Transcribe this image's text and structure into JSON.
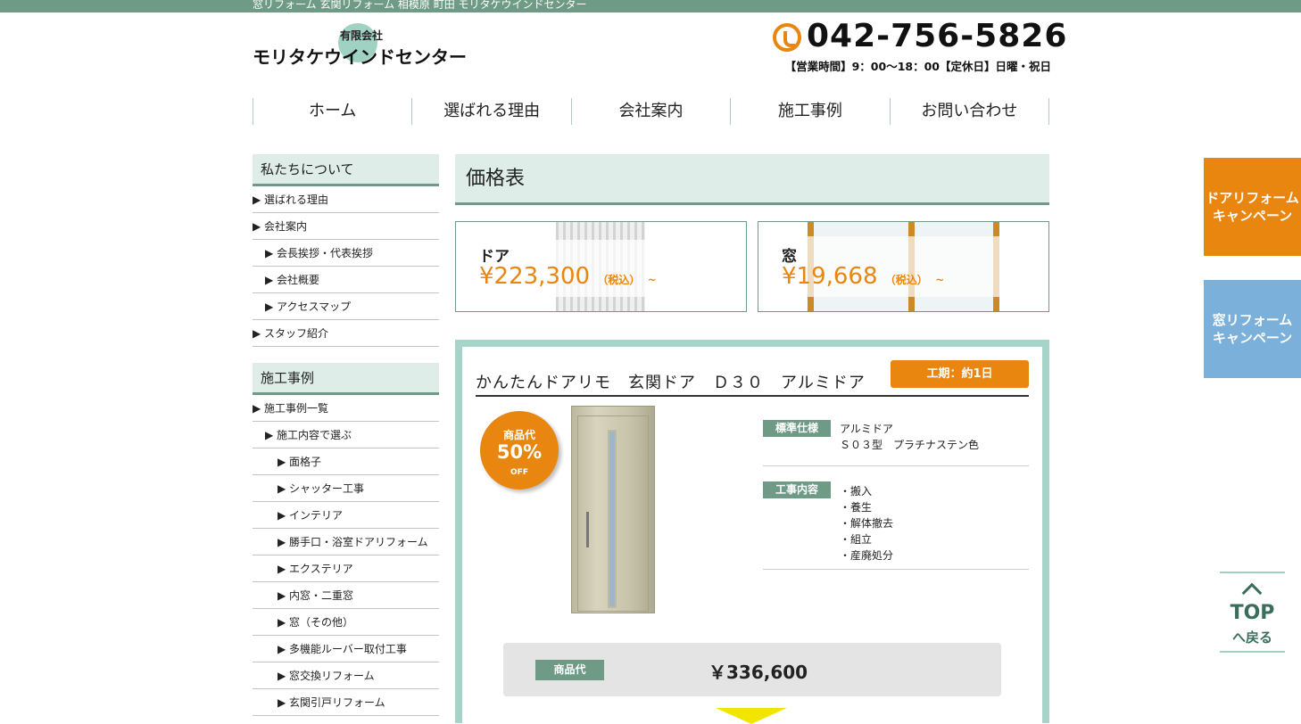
{
  "topbar": {
    "text": "窓リフォーム 玄関リフォーム 相模原 町田 モリタケウインドセンター"
  },
  "logo": {
    "small": "有限会社",
    "main": "モリタケウインドセンター"
  },
  "header": {
    "phone": "042-756-5826",
    "hours": "【営業時間】9：00〜18：00【定休日】日曜・祝日"
  },
  "nav": [
    "ホーム",
    "選ばれる理由",
    "会社案内",
    "施工事例",
    "お問い合わせ"
  ],
  "sidebar": {
    "about_title": "私たちについて",
    "about_items": [
      {
        "label": "▶ 選ばれる理由",
        "level": 0
      },
      {
        "label": "▶ 会社案内",
        "level": 0
      },
      {
        "label": "▶ 会長挨拶・代表挨拶",
        "level": 1
      },
      {
        "label": "▶ 会社概要",
        "level": 1
      },
      {
        "label": "▶ アクセスマップ",
        "level": 1
      },
      {
        "label": "▶ スタッフ紹介",
        "level": 0
      }
    ],
    "works_title": "施工事例",
    "works_items": [
      {
        "label": "▶ 施工事例一覧",
        "level": 0
      },
      {
        "label": "▶ 施工内容で選ぶ",
        "level": 1
      },
      {
        "label": "▶ 面格子",
        "level": 2
      },
      {
        "label": "▶ シャッター工事",
        "level": 2
      },
      {
        "label": "▶ インテリア",
        "level": 2
      },
      {
        "label": "▶ 勝手口・浴室ドアリフォーム",
        "level": 2
      },
      {
        "label": "▶ エクステリア",
        "level": 2
      },
      {
        "label": "▶ 内窓・二重窓",
        "level": 2
      },
      {
        "label": "▶ 窓（その他）",
        "level": 2
      },
      {
        "label": "▶ 多機能ルーバー取付工事",
        "level": 2
      },
      {
        "label": "▶ 窓交換リフォーム",
        "level": 2
      },
      {
        "label": "▶ 玄関引戸リフォーム",
        "level": 2
      }
    ]
  },
  "main": {
    "title": "価格表",
    "door_card": {
      "name": "ドア",
      "price": "¥223,300",
      "tax": "（税込）",
      "suffix": "~"
    },
    "window_card": {
      "name": "窓",
      "price": "¥19,668",
      "tax": "（税込）",
      "suffix": "~"
    },
    "product": {
      "title": "かんたんドアリモ　玄関ドア　Ｄ３０　アルミドア",
      "period": "工期：約1日",
      "discount_label": "商品代",
      "discount_value": "50%",
      "discount_off": "OFF",
      "spec_label": "標準仕様",
      "spec_line1": "アルミドア",
      "spec_line2": "Ｓ０３型　プラチナステン色",
      "work_label": "工事内容",
      "work_items": [
        "・搬入",
        "・養生",
        "・解体撤去",
        "・組立",
        "・産廃処分"
      ],
      "price_label": "商品代",
      "price_value": "￥336,600"
    }
  },
  "campaigns": {
    "door_line1": "ドアリフォーム",
    "door_line2": "キャンペーン",
    "window_line1": "窓リフォーム",
    "window_line2": "キャンペーン"
  },
  "totop": {
    "line1": "TOP",
    "line2": "へ戻る"
  }
}
